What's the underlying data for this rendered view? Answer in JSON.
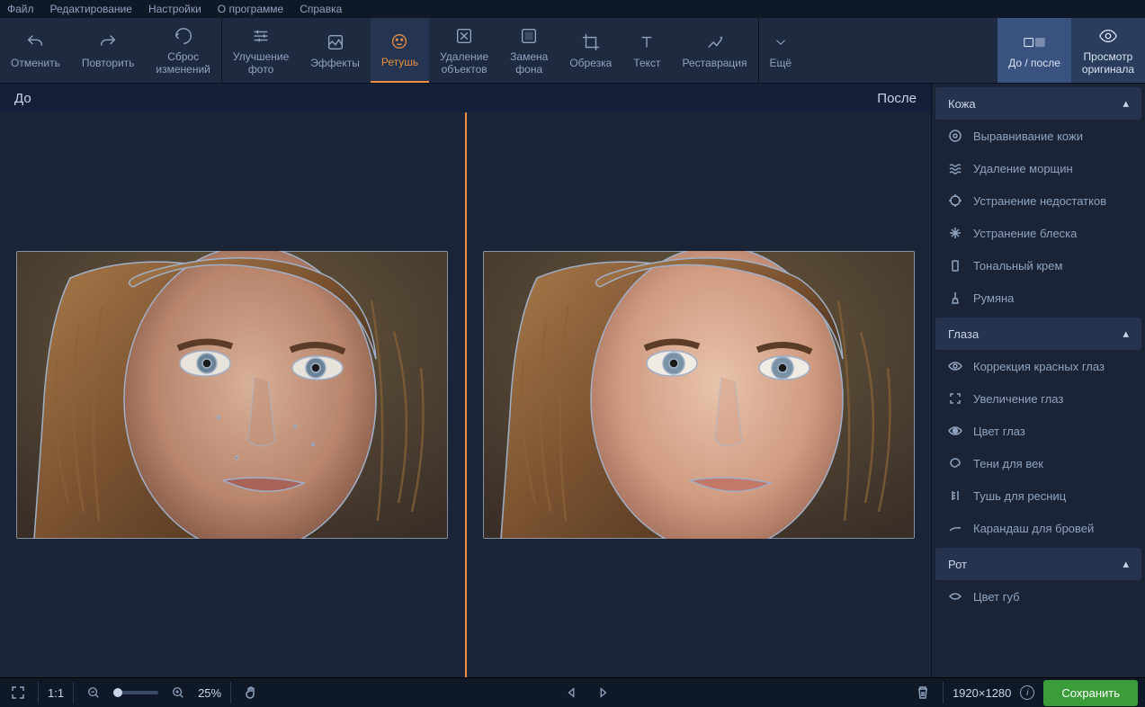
{
  "menu": {
    "file": "Файл",
    "edit": "Редактирование",
    "settings": "Настройки",
    "about": "О программе",
    "help": "Справка"
  },
  "toolbar": {
    "undo": "Отменить",
    "redo": "Повторить",
    "reset": "Сброс\nизменений",
    "enhance": "Улучшение\nфото",
    "effects": "Эффекты",
    "retouch": "Ретушь",
    "remove_objects": "Удаление\nобъектов",
    "replace_bg": "Замена\nфона",
    "crop": "Обрезка",
    "text": "Текст",
    "restore": "Реставрация",
    "more": "Ещё",
    "before_after": "До / после",
    "view_original": "Просмотр\nоригинала"
  },
  "compare": {
    "before": "До",
    "after": "После"
  },
  "panel": {
    "skin": {
      "title": "Кожа",
      "items": [
        "Выравнивание кожи",
        "Удаление морщин",
        "Устранение недостатков",
        "Устранение блеска",
        "Тональный крем",
        "Румяна"
      ]
    },
    "eyes": {
      "title": "Глаза",
      "items": [
        "Коррекция красных глаз",
        "Увеличение глаз",
        "Цвет глаз",
        "Тени для век",
        "Тушь для ресниц",
        "Карандаш для бровей"
      ]
    },
    "mouth": {
      "title": "Рот",
      "items": [
        "Цвет губ"
      ]
    }
  },
  "footer": {
    "one_to_one": "1:1",
    "zoom": "25%",
    "dimensions": "1920×1280",
    "save": "Сохранить"
  }
}
